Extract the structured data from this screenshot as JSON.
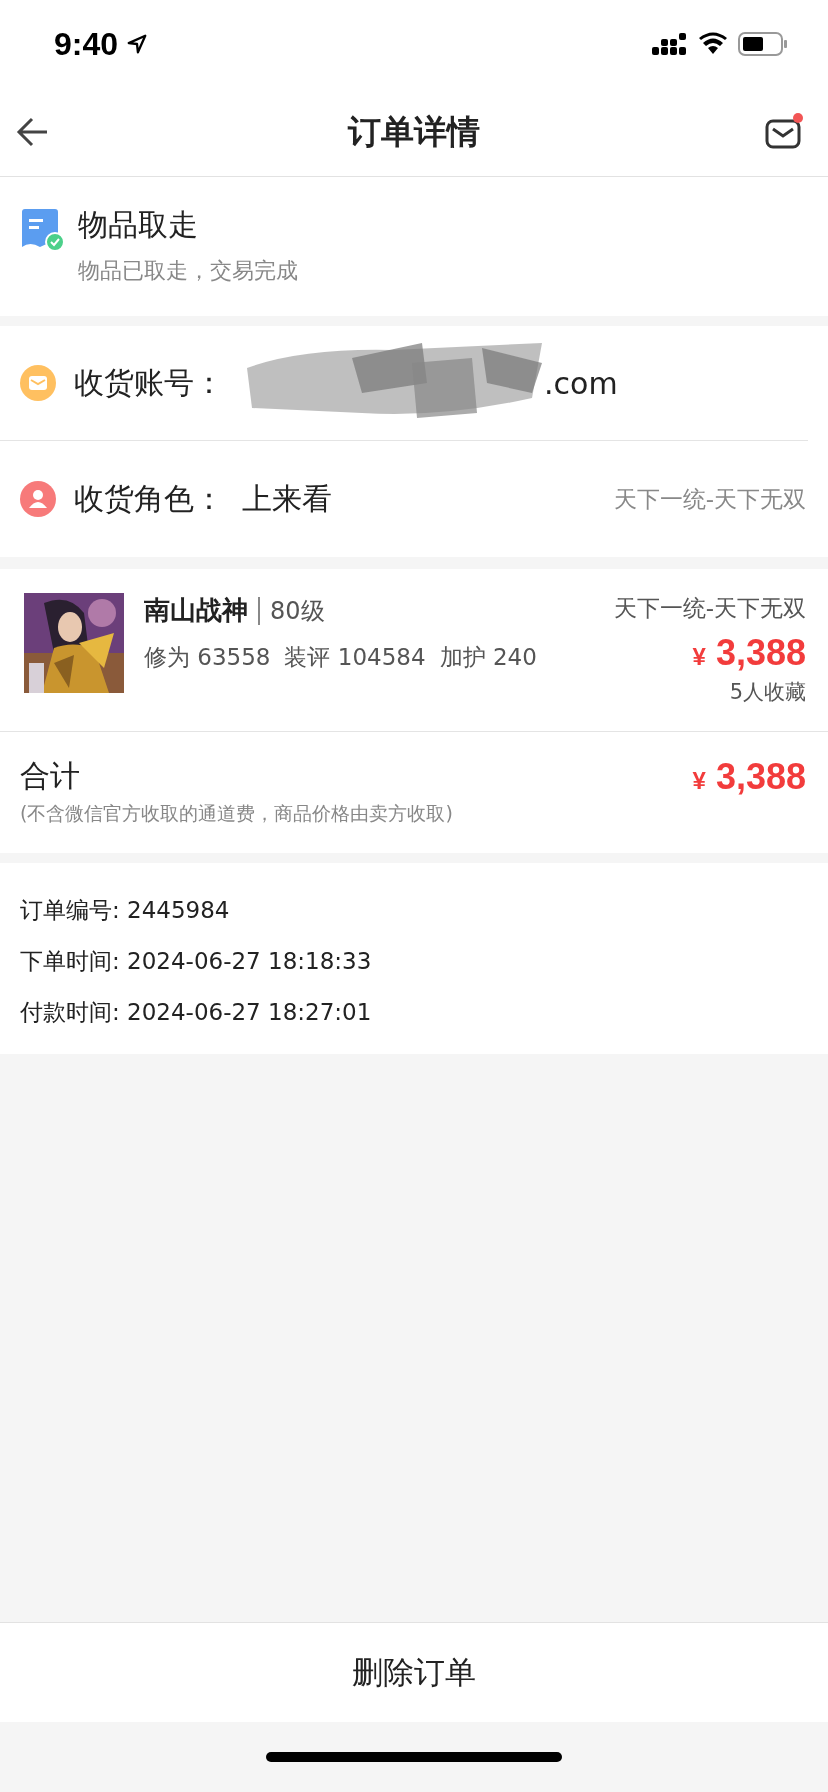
{
  "status_bar": {
    "time": "9:40"
  },
  "nav": {
    "title": "订单详情",
    "has_unread": true
  },
  "order_status": {
    "title": "物品取走",
    "subtitle": "物品已取走，交易完成"
  },
  "receiver": [
    {
      "kind": "account",
      "label": "收货账号：",
      "value": ".com",
      "redacted": true
    },
    {
      "kind": "role",
      "label": "收货角色：",
      "value": "上来看",
      "server": "天下一统-天下无双"
    }
  ],
  "item": {
    "name": "南山战神",
    "level": "80级",
    "stats": [
      "修为 63558",
      "装评 104584",
      "加护 240"
    ],
    "server": "天下一统-天下无双",
    "currency": "¥",
    "price": "3,388",
    "favorites": "5人收藏"
  },
  "total": {
    "label": "合计",
    "note": "(不含微信官方收取的通道费，商品价格由卖方收取)",
    "currency": "¥",
    "amount": "3,388"
  },
  "order_info": [
    "订单编号: 2445984",
    "下单时间: 2024-06-27 18:18:33",
    "付款时间: 2024-06-27 18:27:01"
  ],
  "bottom_button": "删除订单"
}
